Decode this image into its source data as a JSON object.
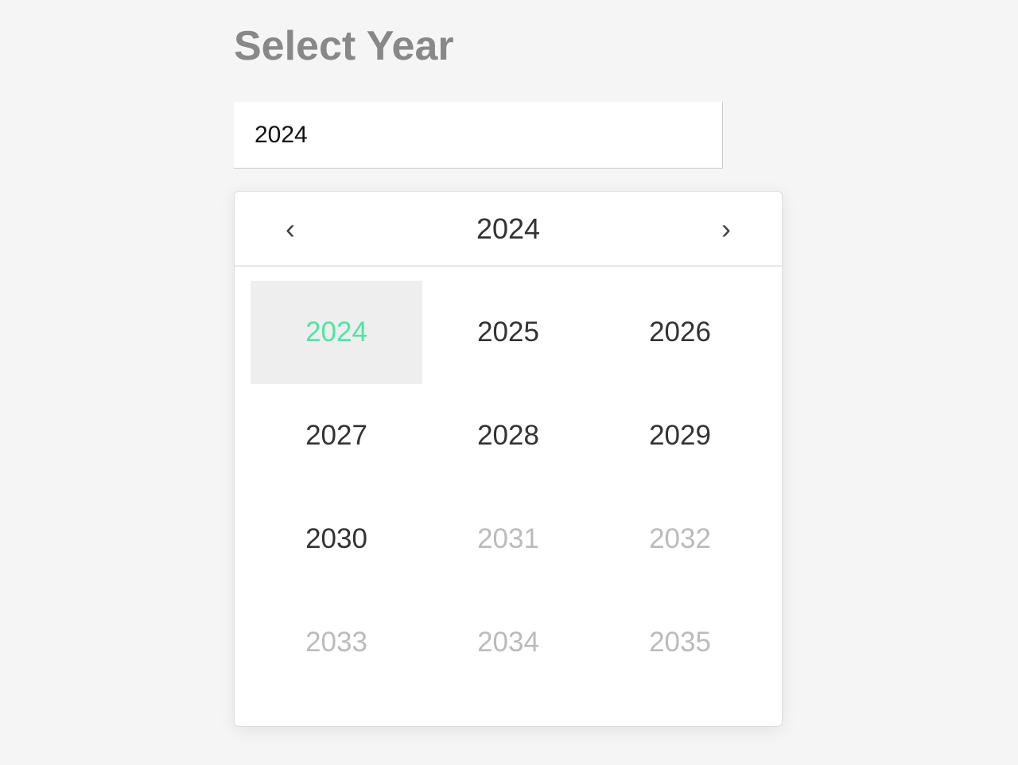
{
  "title": "Select Year",
  "input": {
    "value": "2024"
  },
  "picker": {
    "header_year": "2024",
    "years": [
      {
        "value": "2024",
        "selected": true,
        "disabled": false
      },
      {
        "value": "2025",
        "selected": false,
        "disabled": false
      },
      {
        "value": "2026",
        "selected": false,
        "disabled": false
      },
      {
        "value": "2027",
        "selected": false,
        "disabled": false
      },
      {
        "value": "2028",
        "selected": false,
        "disabled": false
      },
      {
        "value": "2029",
        "selected": false,
        "disabled": false
      },
      {
        "value": "2030",
        "selected": false,
        "disabled": false
      },
      {
        "value": "2031",
        "selected": false,
        "disabled": true
      },
      {
        "value": "2032",
        "selected": false,
        "disabled": true
      },
      {
        "value": "2033",
        "selected": false,
        "disabled": true
      },
      {
        "value": "2034",
        "selected": false,
        "disabled": true
      },
      {
        "value": "2035",
        "selected": false,
        "disabled": true
      }
    ]
  }
}
